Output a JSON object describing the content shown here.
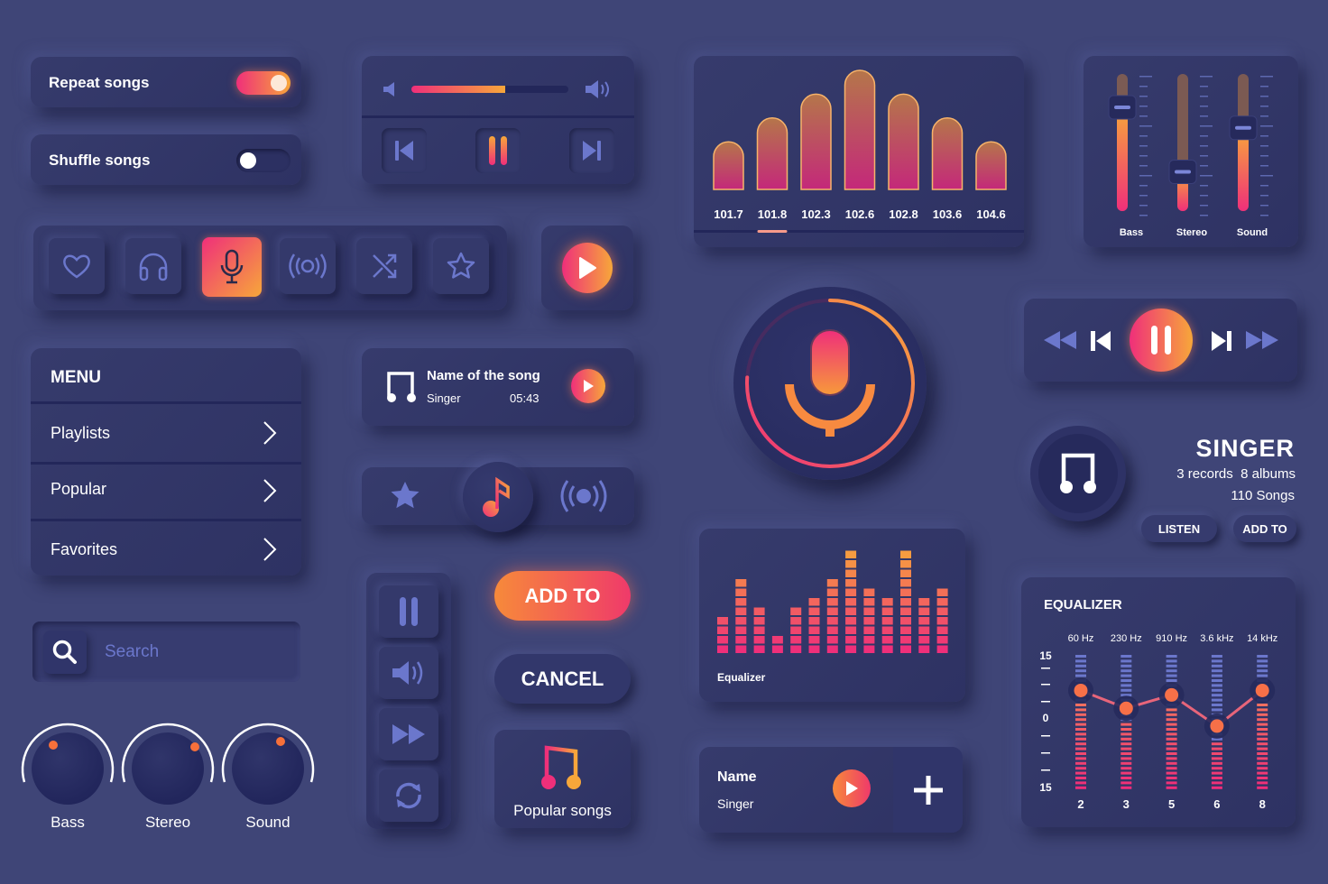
{
  "toggles": [
    {
      "label": "Repeat songs",
      "on": true
    },
    {
      "label": "Shuffle songs",
      "on": false
    }
  ],
  "volume_player": {
    "volume_percent": 60
  },
  "icon_row": {
    "icons": [
      "heart-icon",
      "headphones-icon",
      "microphone-icon",
      "broadcast-icon",
      "shuffle-icon",
      "star-icon"
    ],
    "active": "microphone-icon"
  },
  "radio_chart": {
    "chart_data": {
      "type": "bar",
      "categories": [
        "101.7",
        "101.8",
        "102.3",
        "102.6",
        "102.8",
        "103.6",
        "104.6"
      ],
      "values": [
        2,
        3,
        4,
        5,
        4,
        3,
        2
      ],
      "selected": "101.8"
    }
  },
  "mixer": {
    "sliders": [
      {
        "label": "Bass",
        "value": 0.75
      },
      {
        "label": "Stereo",
        "value": 0.28
      },
      {
        "label": "Sound",
        "value": 0.6
      }
    ]
  },
  "menu": {
    "title": "MENU",
    "items": [
      {
        "label": "Playlists"
      },
      {
        "label": "Popular"
      },
      {
        "label": "Favorites"
      }
    ]
  },
  "now_playing": {
    "title": "Name of the song",
    "artist": "Singer",
    "duration": "05:43"
  },
  "transport": {
    "state": "paused"
  },
  "singer": {
    "name": "SINGER",
    "records": "3 records",
    "albums": "8 albums",
    "songs": "110 Songs",
    "listen_label": "LISTEN",
    "add_label": "ADD TO"
  },
  "search": {
    "placeholder": "Search"
  },
  "knobs": [
    {
      "label": "Bass"
    },
    {
      "label": "Stereo"
    },
    {
      "label": "Sound"
    }
  ],
  "buttons": {
    "add_label": "ADD TO",
    "cancel_label": "CANCEL",
    "popular_label": "Popular songs"
  },
  "equalizer_small": {
    "label": "Equalizer",
    "chart_data": {
      "type": "bar",
      "values": [
        4,
        8,
        5,
        2,
        5,
        6,
        8,
        11,
        7,
        6,
        11,
        6,
        7
      ]
    }
  },
  "track": {
    "name": "Name",
    "artist": "Singer"
  },
  "equalizer": {
    "title": "EQUALIZER",
    "chart_data": {
      "type": "line",
      "bands": [
        "60 Hz",
        "230 Hz",
        "910 Hz",
        "3.6 kHz",
        "14 kHz"
      ],
      "band_values": [
        "2",
        "3",
        "5",
        "6",
        "8"
      ],
      "levels": [
        7,
        3,
        6,
        -1,
        7
      ],
      "y_ticks": [
        "15",
        "0",
        "15"
      ],
      "ylim": [
        -15,
        15
      ]
    }
  }
}
